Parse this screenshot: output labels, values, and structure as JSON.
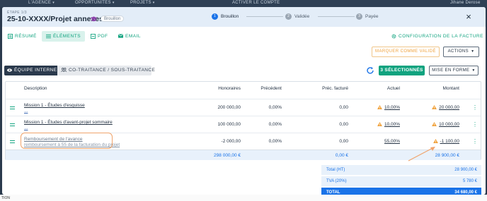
{
  "background_nav": {
    "agence": "L'AGENCE",
    "opportunites": "OPPORTUNITÉS",
    "projets": "PROJETS",
    "activer": "ACTIVER LE COMPTE",
    "user": "Jihane Derose",
    "footer_text": "TION"
  },
  "modal": {
    "etape": "ÉTAPE 1/3",
    "reference": "25-10-XXXX/Projet annexes I",
    "status_badge": "Brouillon",
    "steps": [
      {
        "num": "1",
        "label": "Brouillon"
      },
      {
        "num": "2",
        "label": "Validée"
      },
      {
        "num": "3",
        "label": "Payée"
      }
    ],
    "close_symbol": "×"
  },
  "tabs": [
    {
      "label": "RÉSUMÉ",
      "icon": "summary-icon"
    },
    {
      "label": "ÉLÉMENTS",
      "icon": "list-icon"
    },
    {
      "label": "PDF",
      "icon": "pdf-icon"
    },
    {
      "label": "EMAIL",
      "icon": "email-icon"
    }
  ],
  "config_label": "CONFIGURATION DE LA FACTURE",
  "buttons": {
    "marquer": "MARQUER COMME VALIDÉ",
    "actions": "ACTIONS",
    "equipe": "ÉQUIPE INTERNE",
    "cotraitance": "CO-TRAITANCE / SOUS-TRAITANCE",
    "selected": "3 SÉLECTIONNÉS",
    "mise_en_forme": "MISE EN FORME"
  },
  "table": {
    "headers": [
      "Description",
      "Honoraires",
      "Précédent",
      "Préc. facturé",
      "Actuel",
      "Montant"
    ],
    "rows": [
      {
        "desc": "Mission 1 - Études d'esquisse",
        "sub": "...",
        "honoraires": "200 000,00",
        "precedent": "0,00%",
        "prec_facture": "0,00",
        "actuel": "10,00%",
        "montant": "20 000,00"
      },
      {
        "desc": "Mission 1 - Études d'avant-projet sommaire",
        "sub": "...",
        "honoraires": "100 000,00",
        "precedent": "0,00%",
        "prec_facture": "0,00",
        "actuel": "10,00%",
        "montant": "10 000,00"
      },
      {
        "desc": "Remboursement de l'avance",
        "sub": "remboursement à 55 de la facturation du projet",
        "honoraires": "-2 000,00",
        "precedent": "0,00%",
        "prec_facture": "0,00",
        "actuel": "55,00%",
        "montant": "-1 100,00"
      }
    ],
    "totals": {
      "honoraires": "298 000,00 €",
      "prec_facture": "0,00 €",
      "montant": "28 900,00 €"
    }
  },
  "summary": [
    {
      "label": "Total (HT)",
      "value": "28 900,00 €"
    },
    {
      "label": "TVA (20%)",
      "value": "5 780 €"
    },
    {
      "label": "TOTAL",
      "value": "34 680,00 €"
    }
  ],
  "colors": {
    "accent_green": "#10a37f",
    "accent_blue": "#1a73e8",
    "warning_orange": "#f0a23c",
    "header_bg": "#e3edf8"
  }
}
